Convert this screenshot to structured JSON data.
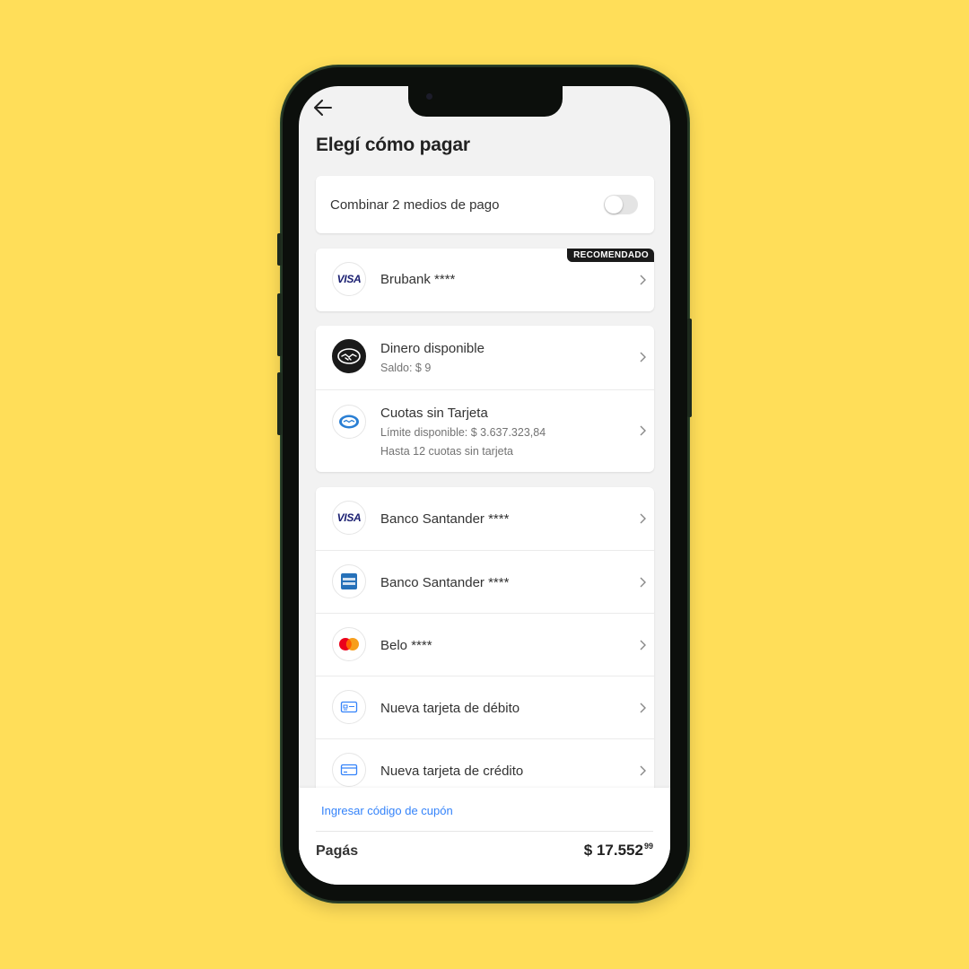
{
  "header": {
    "title": "Elegí cómo pagar"
  },
  "combine": {
    "label": "Combinar 2 medios de pago",
    "enabled": false
  },
  "recommended": {
    "badge": "RECOMENDADO",
    "brand": "VISA",
    "title": "Brubank ****"
  },
  "account": {
    "items": [
      {
        "icon": "mercado-pago-handshake-icon",
        "title": "Dinero disponible",
        "sub": [
          "Saldo: $ 9"
        ]
      },
      {
        "icon": "mercado-credito-icon",
        "title": "Cuotas sin Tarjeta",
        "sub": [
          "Límite disponible: $ 3.637.323,84",
          "Hasta 12 cuotas sin tarjeta"
        ]
      }
    ]
  },
  "cards": {
    "items": [
      {
        "icon": "visa-icon",
        "brand": "VISA",
        "title": "Banco Santander ****"
      },
      {
        "icon": "amex-icon",
        "brand": "AMERICAN EXPRESS",
        "title": "Banco Santander ****"
      },
      {
        "icon": "mastercard-icon",
        "title": "Belo ****"
      },
      {
        "icon": "debit-card-icon",
        "title": "Nueva tarjeta de débito"
      },
      {
        "icon": "credit-card-icon",
        "title": "Nueva tarjeta de crédito"
      }
    ]
  },
  "footer": {
    "coupon": "Ingresar código de cupón",
    "pay_label": "Pagás",
    "amount_main": "$ 17.552",
    "amount_cents": "99"
  },
  "colors": {
    "background": "#FFDE59",
    "link": "#3483fa",
    "badge": "#1a1a1a"
  }
}
